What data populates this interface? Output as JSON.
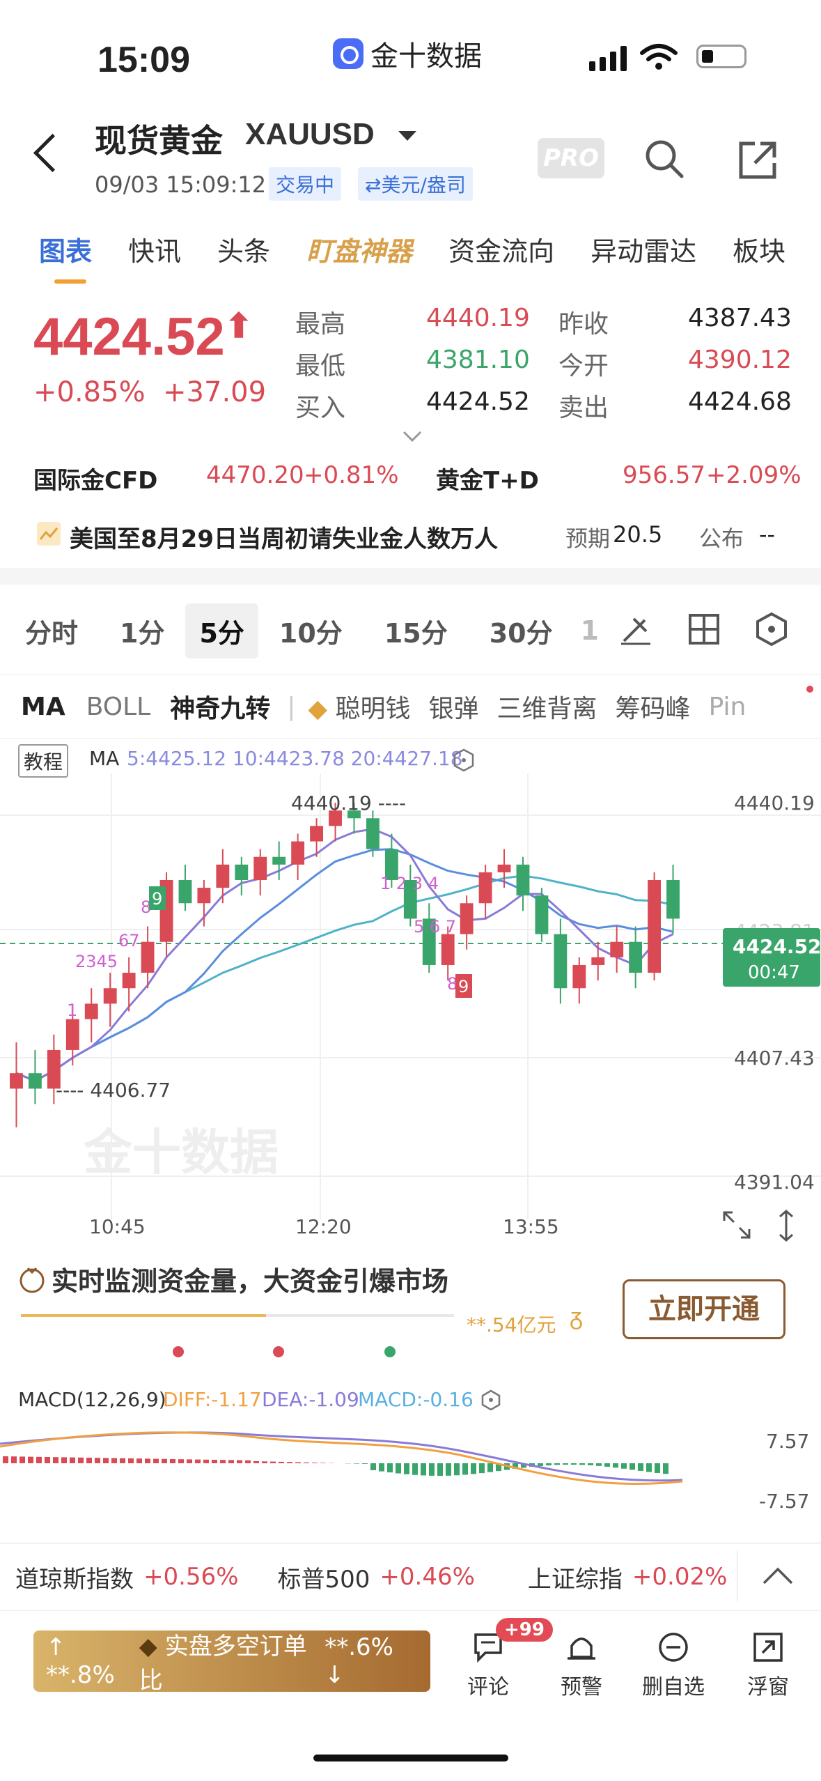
{
  "status_bar": {
    "time": "15:09",
    "app_name": "金十数据"
  },
  "header": {
    "title": "现货黄金",
    "symbol": "XAUUSD",
    "datetime": "09/03 15:09:12",
    "trading_status": "交易中",
    "unit": "⇄美元/盎司",
    "pro_label": "PRO"
  },
  "tabs": [
    "图表",
    "快讯",
    "头条",
    "盯盘神器",
    "资金流向",
    "异动雷达",
    "板块"
  ],
  "quote": {
    "price": "4424.52",
    "change_pct": "+0.85%",
    "change_abs": "+37.09",
    "high_label": "最高",
    "high": "4440.19",
    "low_label": "最低",
    "low": "4381.10",
    "bid_label": "买入",
    "bid": "4424.52",
    "prev_close_label": "昨收",
    "prev_close": "4387.43",
    "open_label": "今开",
    "open": "4390.12",
    "ask_label": "卖出",
    "ask": "4424.68"
  },
  "related": {
    "cfd_label": "国际金CFD",
    "cfd_price": "4470.20",
    "cfd_pct": "+0.81%",
    "td_label": "黄金T+D",
    "td_price": "956.57",
    "td_pct": "+2.09%"
  },
  "news": {
    "text": "美国至8月29日当周初请失业金人数万人",
    "expected_label": "预期",
    "expected": "20.5",
    "publish_label": "公布",
    "publish": "--"
  },
  "periods": [
    "分时",
    "1分",
    "5分",
    "10分",
    "15分",
    "30分",
    "1"
  ],
  "selected_period": "5分",
  "indicators": [
    "MA",
    "BOLL",
    "神奇九转",
    "聪明钱",
    "银弹",
    "三维背离",
    "筹码峰",
    "Pin"
  ],
  "chart": {
    "tutorial_label": "教程",
    "ma_label": "MA",
    "ma_values": "5:4425.12 10:4423.78 20:4427.18",
    "high_marker": "4440.19 ----",
    "low_marker": "---- 4406.77",
    "y_ticks": [
      "4440.19",
      "4407.43",
      "4391.04"
    ],
    "current_price": "4424.52",
    "countdown": "00:47",
    "x_ticks": [
      "10:45",
      "12:20",
      "13:55"
    ],
    "watermark": "金十数据",
    "hidden_tick": "4423.81"
  },
  "promo": {
    "title": "实时监测资金量，大资金引爆市场",
    "amount": "**.54亿元",
    "button": "立即开通"
  },
  "macd": {
    "label": "MACD(12,26,9)",
    "diff": "DIFF:-1.17",
    "dea": "DEA:-1.09",
    "macd": "MACD:-0.16",
    "y_top": "7.57",
    "y_bottom": "-7.57"
  },
  "index_bar": [
    {
      "name": "道琼斯指数",
      "pct": "+0.56%"
    },
    {
      "name": "标普500",
      "pct": "+0.46%"
    },
    {
      "name": "上证综指",
      "pct": "+0.02%"
    }
  ],
  "bottom": {
    "left_pct": "**.8%",
    "center_label": "实盘多空订单比",
    "right_pct": "**.6%",
    "comment": "评论",
    "badge": "+99",
    "alert": "预警",
    "remove": "删自选",
    "float": "浮窗"
  },
  "colors": {
    "up": "#d94a54",
    "down": "#3aa56a",
    "accent": "#3a6fd8",
    "ma5": "#6a5acd",
    "ma10": "#5a8de0",
    "ma20": "#4fb3c8"
  },
  "chart_data": {
    "type": "candlestick",
    "ylim": [
      4391.04,
      4440.19
    ],
    "candles": [
      [
        4403,
        4409,
        4398,
        4405
      ],
      [
        4405,
        4408,
        4401,
        4403
      ],
      [
        4403,
        4410,
        4401,
        4408
      ],
      [
        4408,
        4414,
        4406,
        4412
      ],
      [
        4412,
        4416,
        4409,
        4414
      ],
      [
        4414,
        4418,
        4411,
        4416
      ],
      [
        4416,
        4420,
        4413,
        4418
      ],
      [
        4418,
        4424,
        4416,
        4422
      ],
      [
        4422,
        4431,
        4420,
        4430
      ],
      [
        4430,
        4432,
        4426,
        4427
      ],
      [
        4427,
        4430,
        4424,
        4429
      ],
      [
        4429,
        4434,
        4427,
        4432
      ],
      [
        4432,
        4433,
        4428,
        4430
      ],
      [
        4430,
        4434,
        4428,
        4433
      ],
      [
        4433,
        4435,
        4430,
        4432
      ],
      [
        4432,
        4436,
        4430,
        4435
      ],
      [
        4435,
        4438,
        4433,
        4437
      ],
      [
        4437,
        4440,
        4435,
        4439
      ],
      [
        4439,
        4440,
        4436,
        4438
      ],
      [
        4438,
        4439,
        4433,
        4434
      ],
      [
        4434,
        4436,
        4429,
        4430
      ],
      [
        4430,
        4432,
        4424,
        4425
      ],
      [
        4425,
        4427,
        4418,
        4419
      ],
      [
        4419,
        4424,
        4417,
        4423
      ],
      [
        4423,
        4428,
        4421,
        4427
      ],
      [
        4427,
        4432,
        4425,
        4431
      ],
      [
        4431,
        4434,
        4429,
        4432
      ],
      [
        4432,
        4433,
        4426,
        4428
      ],
      [
        4428,
        4429,
        4422,
        4423
      ],
      [
        4423,
        4425,
        4414,
        4416
      ],
      [
        4416,
        4420,
        4414,
        4419
      ],
      [
        4419,
        4422,
        4417,
        4420
      ],
      [
        4420,
        4424,
        4418,
        4422
      ],
      [
        4422,
        4424,
        4416,
        4418
      ],
      [
        4418,
        4431,
        4417,
        4430
      ],
      [
        4430,
        4432,
        4423,
        4425
      ]
    ]
  }
}
